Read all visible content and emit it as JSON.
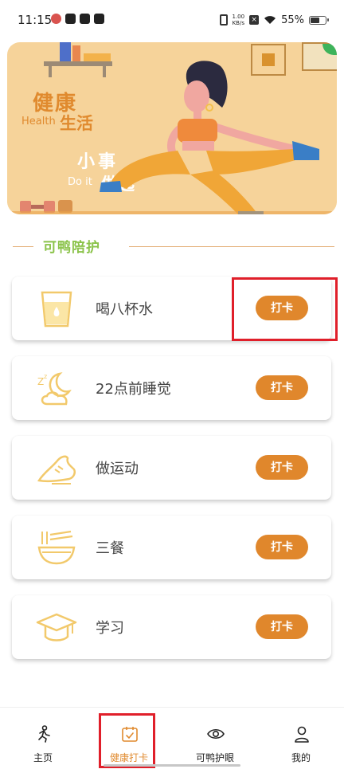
{
  "status_bar": {
    "time": "11:15",
    "speed_value": "1.00",
    "speed_unit": "KB/s",
    "battery": "55%"
  },
  "banner": {
    "title_main": "健康",
    "title_en": "Health",
    "title_sub": "生活",
    "slogan_main": "小事",
    "slogan_en": "Do it",
    "slogan_sub": "做起"
  },
  "section": {
    "title": "可鸭陪护"
  },
  "tasks": [
    {
      "label": "喝八杯水",
      "icon": "water-cup-icon",
      "button": "打卡"
    },
    {
      "label": "22点前睡觉",
      "icon": "moon-cloud-icon",
      "button": "打卡"
    },
    {
      "label": "做运动",
      "icon": "sneaker-icon",
      "button": "打卡"
    },
    {
      "label": "三餐",
      "icon": "noodle-bowl-icon",
      "button": "打卡"
    },
    {
      "label": "学习",
      "icon": "graduation-cap-icon",
      "button": "打卡"
    }
  ],
  "bottom_nav": {
    "items": [
      {
        "label": "主页",
        "icon": "running-person-icon",
        "active": false
      },
      {
        "label": "健康打卡",
        "icon": "calendar-check-icon",
        "active": true
      },
      {
        "label": "可鸭护眼",
        "icon": "eye-icon",
        "active": false
      },
      {
        "label": "我的",
        "icon": "user-icon",
        "active": false
      }
    ]
  },
  "colors": {
    "accent": "#e0872c",
    "section_title": "#8bc34a",
    "highlight": "#e01f2a",
    "banner_bg": "#f6d39a"
  }
}
